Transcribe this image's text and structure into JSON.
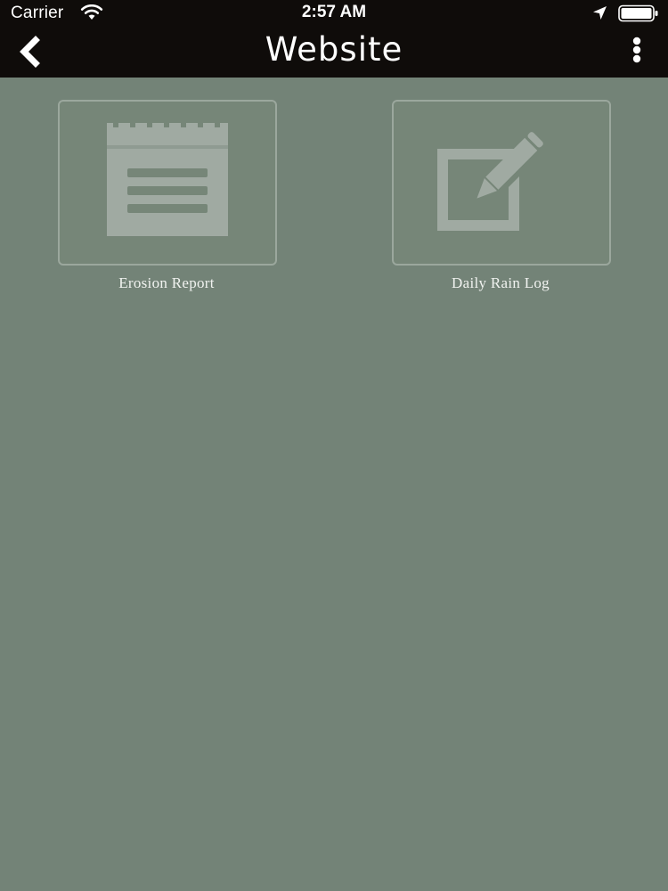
{
  "status_bar": {
    "carrier": "Carrier",
    "time": "2:57 AM",
    "icons": [
      "wifi-icon",
      "location-arrow-icon",
      "battery-icon"
    ]
  },
  "nav": {
    "title": "Website",
    "back_icon": "chevron-left-icon",
    "menu_icon": "vertical-ellipsis-icon"
  },
  "tiles": [
    {
      "label": "Erosion Report",
      "icon": "notepad-icon"
    },
    {
      "label": "Daily Rain Log",
      "icon": "edit-checkbox-pencil-icon"
    }
  ],
  "colors": {
    "background": "#738377",
    "nav_background": "#0f0c0a",
    "tile_border": "#9ba79d",
    "icon_fill": "#a0aaa2",
    "label_text": "#f1f3f0"
  }
}
